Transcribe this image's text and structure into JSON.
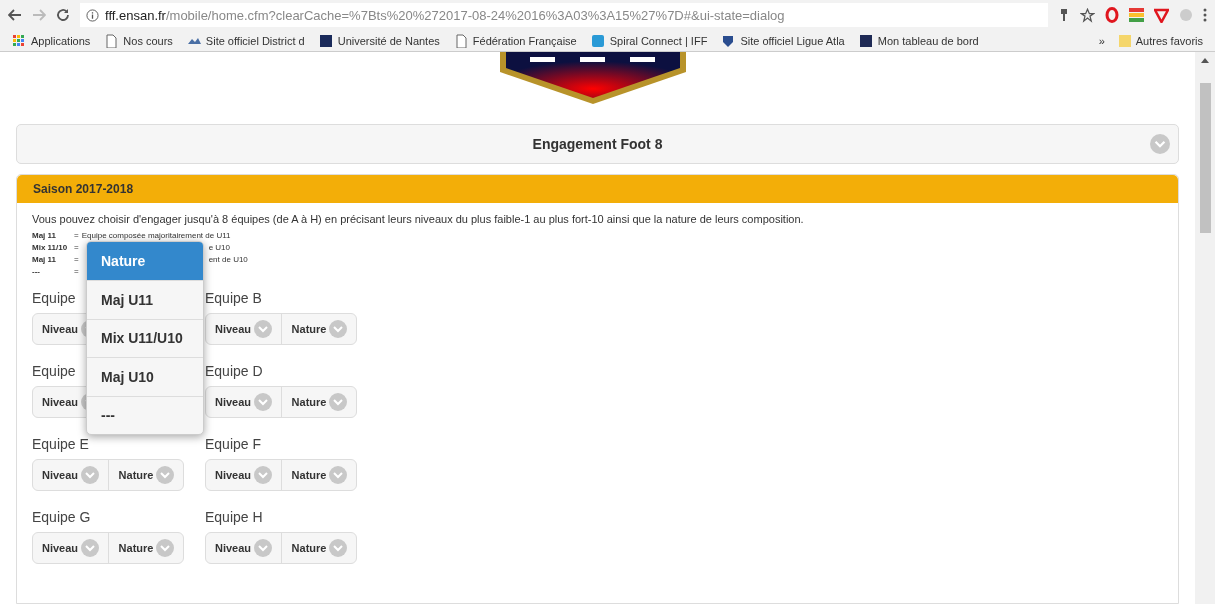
{
  "browser": {
    "url_host": "fff.ensan.fr",
    "url_path": "/mobile/home.cfm?clearCache=%7Bts%20%272017-08-24%2016%3A03%3A15%27%7D#&ui-state=dialog",
    "bookmarks": [
      {
        "label": "Applications"
      },
      {
        "label": "Nos cours"
      },
      {
        "label": "Site officiel District d"
      },
      {
        "label": "Université de Nantes"
      },
      {
        "label": "Fédération Française"
      },
      {
        "label": "Spiral Connect | IFF"
      },
      {
        "label": "Site officiel Ligue Atla"
      },
      {
        "label": "Mon tableau de bord"
      }
    ],
    "more": "»",
    "other_bookmarks": "Autres favoris"
  },
  "header": {
    "title": "Engagement Foot 8",
    "expanded": true
  },
  "season": {
    "title": "Saison 2017-2018",
    "intro": "Vous pouvez choisir d'engager jusqu'à 8 équipes (de A à H) en précisant leurs niveaux du plus faible-1 au plus fort-10 ainsi que la nature de leurs composition.",
    "legend": [
      {
        "term": "Maj 11",
        "eq": "=",
        "text": "Equipe composée majoritairement de U11",
        "kind": "full"
      },
      {
        "term": "Mix 11/10",
        "eq": "=",
        "text": "e U10",
        "kind": "covered"
      },
      {
        "term": "Maj 11",
        "eq": "=",
        "text": "ent de U10",
        "kind": "covered"
      },
      {
        "term": "---",
        "eq": "=",
        "kind": "covered"
      }
    ],
    "teams": [
      {
        "label": "Equipe",
        "buttons": [
          "Niveau"
        ]
      },
      {
        "label": "Equipe B",
        "buttons": [
          "Niveau",
          "Nature"
        ]
      },
      {
        "label": "Equipe",
        "buttons": [
          "Niveau"
        ]
      },
      {
        "label": "Equipe D",
        "buttons": [
          "Niveau",
          "Nature"
        ]
      },
      {
        "label": "Equipe E",
        "buttons": [
          "Niveau",
          "Nature"
        ]
      },
      {
        "label": "Equipe F",
        "buttons": [
          "Niveau",
          "Nature"
        ]
      },
      {
        "label": "Equipe G",
        "buttons": [
          "Niveau",
          "Nature"
        ]
      },
      {
        "label": "Equipe H",
        "buttons": [
          "Niveau",
          "Nature"
        ]
      }
    ]
  },
  "popup": {
    "title": "Nature",
    "options": [
      "Maj U11",
      "Mix U11/U10",
      "Maj U10",
      "---"
    ]
  }
}
